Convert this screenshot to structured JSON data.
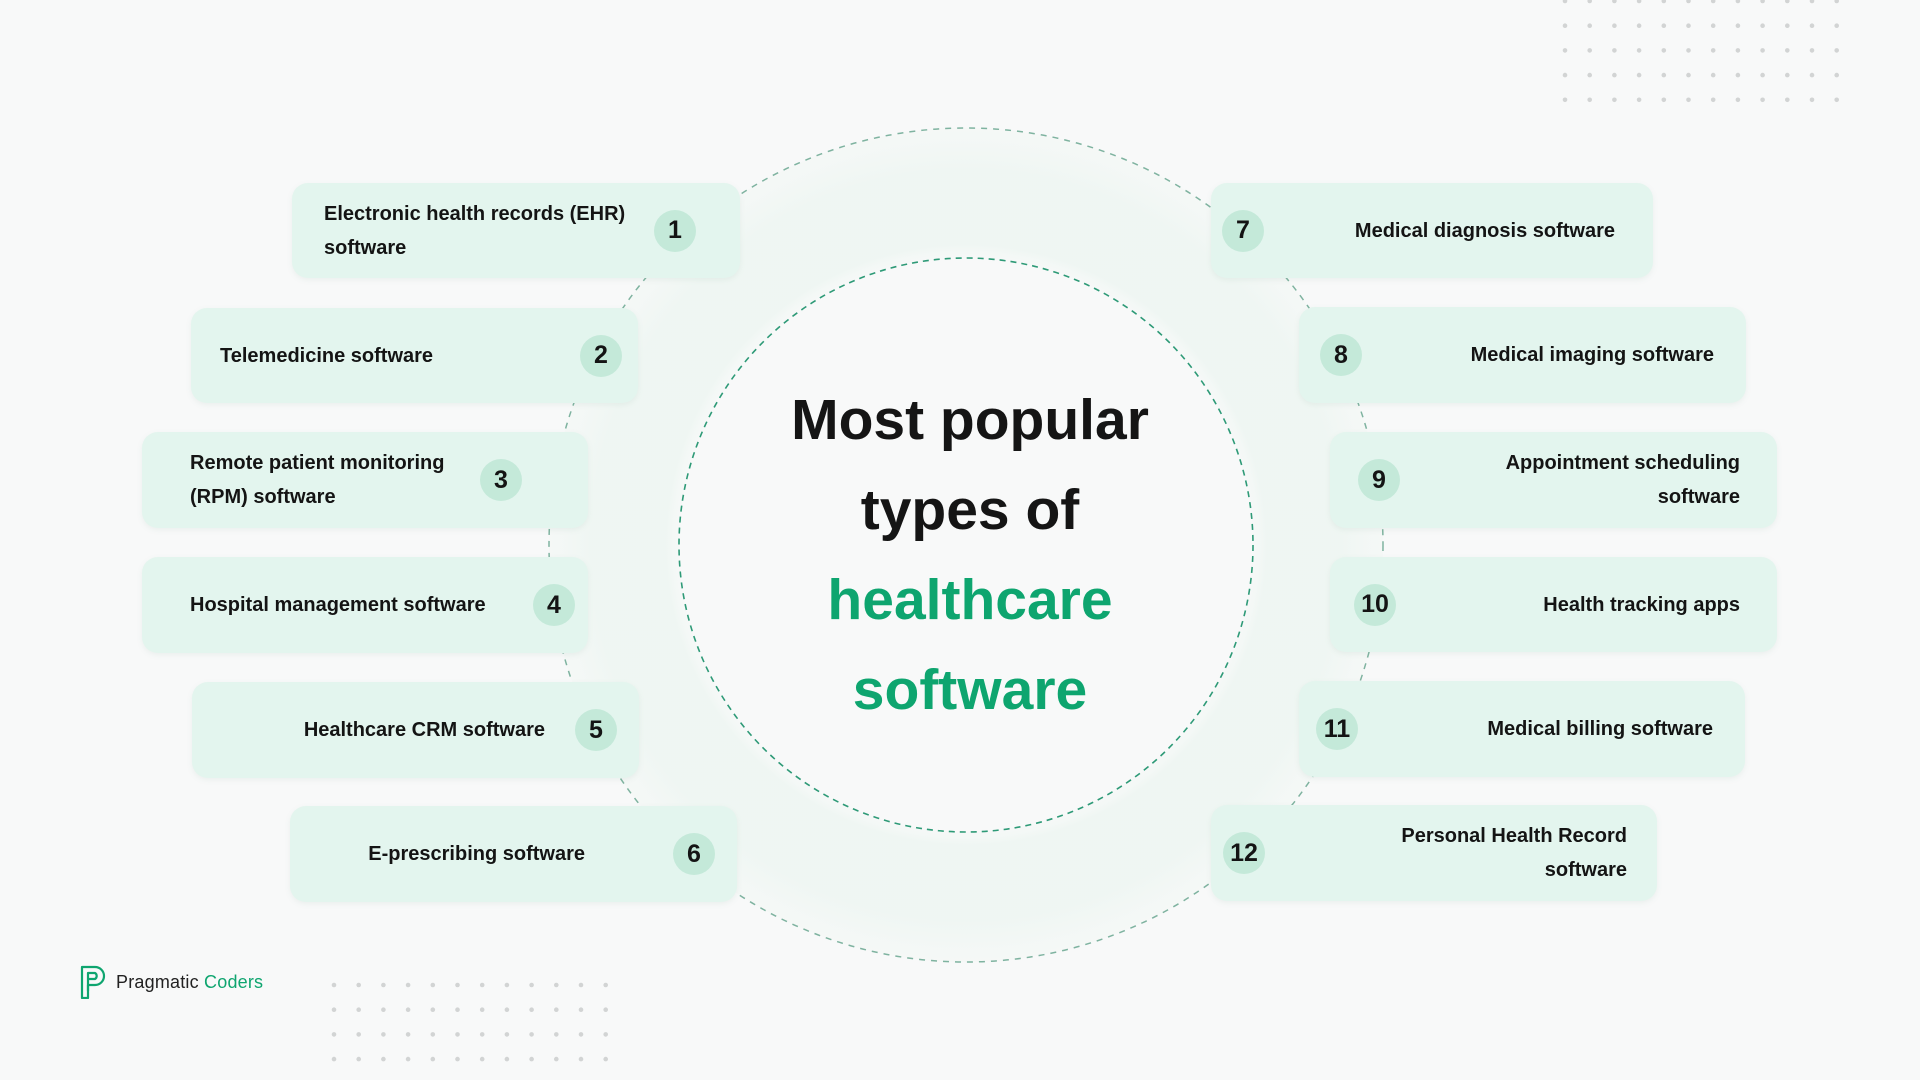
{
  "title": {
    "line1": "Most popular",
    "line2": "types of",
    "line3": "healthcare",
    "line4": "software"
  },
  "colors": {
    "accent": "#0ea56f",
    "card_bg": "#e3f5ee",
    "badge_bg": "#c4e9d9",
    "text": "#141414",
    "background": "#f8f9f9"
  },
  "items": [
    {
      "number": "1",
      "label": "Electronic health records (EHR) software"
    },
    {
      "number": "2",
      "label": "Telemedicine software"
    },
    {
      "number": "3",
      "label": "Remote patient monitoring (RPM) software"
    },
    {
      "number": "4",
      "label": "Hospital management software"
    },
    {
      "number": "5",
      "label": "Healthcare CRM software"
    },
    {
      "number": "6",
      "label": "E-prescribing software"
    },
    {
      "number": "7",
      "label": "Medical diagnosis software"
    },
    {
      "number": "8",
      "label": "Medical imaging software"
    },
    {
      "number": "9",
      "label": "Appointment scheduling software"
    },
    {
      "number": "10",
      "label": "Health tracking apps"
    },
    {
      "number": "11",
      "label": "Medical billing software"
    },
    {
      "number": "12",
      "label": "Personal Health Record software"
    }
  ],
  "logo": {
    "icon": "pragmatic-coders-p-logo",
    "name_part1": "Pragmatic",
    "name_part2": "Coders"
  }
}
